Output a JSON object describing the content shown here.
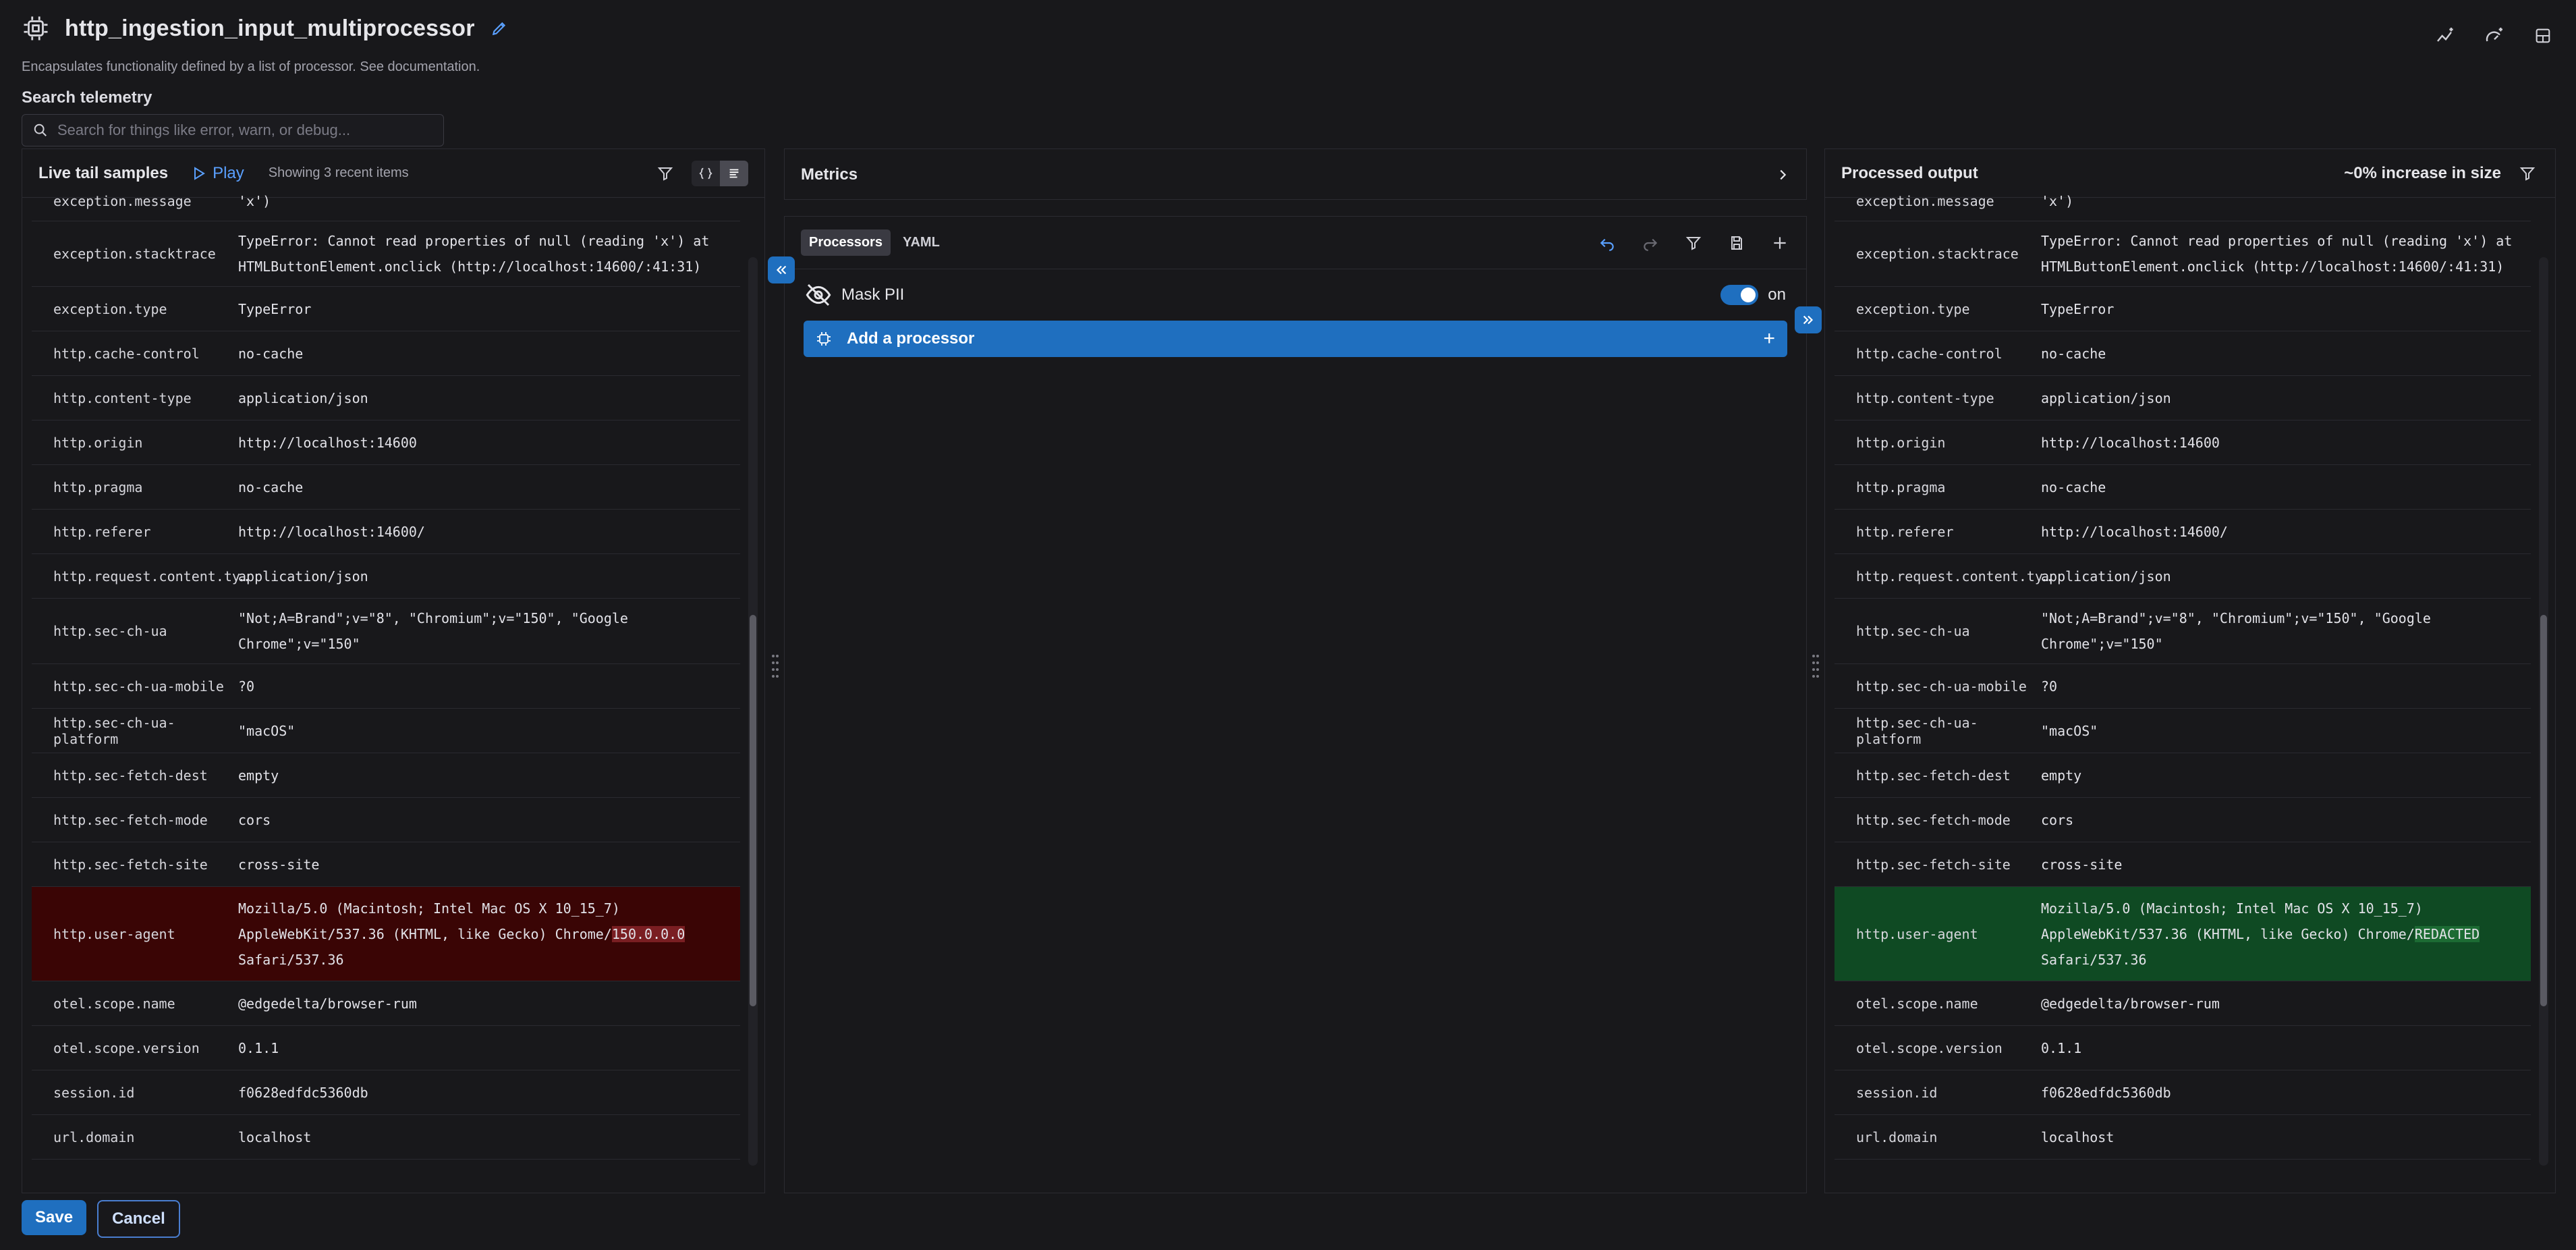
{
  "header": {
    "title": "http_ingestion_input_multiprocessor",
    "subtitle": "Encapsulates functionality defined by a list of processor. See documentation.",
    "search_label": "Search telemetry",
    "search_placeholder": "Search for things like error, warn, or debug..."
  },
  "left": {
    "title": "Live tail samples",
    "play": "Play",
    "showing": "Showing 3 recent items"
  },
  "metrics": {
    "title": "Metrics"
  },
  "processors": {
    "tabs": [
      "Processors",
      "YAML"
    ],
    "mask_label": "Mask PII",
    "switch_label": "on",
    "add_label": "Add a processor"
  },
  "right": {
    "title": "Processed output",
    "size": "~0% increase in size"
  },
  "rows": [
    {
      "k": "exception.message",
      "v": "'x')"
    },
    {
      "k": "exception.stacktrace",
      "v": "TypeError: Cannot read properties of null (reading 'x') at HTMLButtonElement.onclick (http://localhost:14600/:41:31)"
    },
    {
      "k": "exception.type",
      "v": "TypeError"
    },
    {
      "k": "http.cache-control",
      "v": "no-cache"
    },
    {
      "k": "http.content-type",
      "v": "application/json"
    },
    {
      "k": "http.origin",
      "v": "http://localhost:14600"
    },
    {
      "k": "http.pragma",
      "v": "no-cache"
    },
    {
      "k": "http.referer",
      "v": "http://localhost:14600/"
    },
    {
      "k": "http.request.content.ty…",
      "v": "application/json"
    },
    {
      "k": "http.sec-ch-ua",
      "v": "\"Not;A=Brand\";v=\"8\", \"Chromium\";v=\"150\", \"Google Chrome\";v=\"150\""
    },
    {
      "k": "http.sec-ch-ua-mobile",
      "v": "?0"
    },
    {
      "k": "http.sec-ch-ua-platform",
      "v": "\"macOS\""
    },
    {
      "k": "http.sec-fetch-dest",
      "v": "empty"
    },
    {
      "k": "http.sec-fetch-mode",
      "v": "cors"
    },
    {
      "k": "http.sec-fetch-site",
      "v": "cross-site"
    },
    {
      "k": "http.user-agent",
      "v_pre": "Mozilla/5.0 (Macintosh; Intel Mac OS X 10_15_7) AppleWebKit/537.36 (KHTML, like Gecko) Chrome/",
      "v_left_hl": "150.0.0.0",
      "v_right_hl": "REDACTED",
      "v_post": " Safari/537.36",
      "highlight": true
    },
    {
      "k": "otel.scope.name",
      "v": "@edgedelta/browser-rum"
    },
    {
      "k": "otel.scope.version",
      "v": "0.1.1"
    },
    {
      "k": "session.id",
      "v": "f0628edfdc5360db"
    },
    {
      "k": "url.domain",
      "v": "localhost"
    }
  ],
  "footer": {
    "save": "Save",
    "cancel": "Cancel"
  },
  "colors": {
    "accent": "#1f6fbf",
    "removed_bg": "#3a0505",
    "added_bg": "#0f4a23"
  }
}
